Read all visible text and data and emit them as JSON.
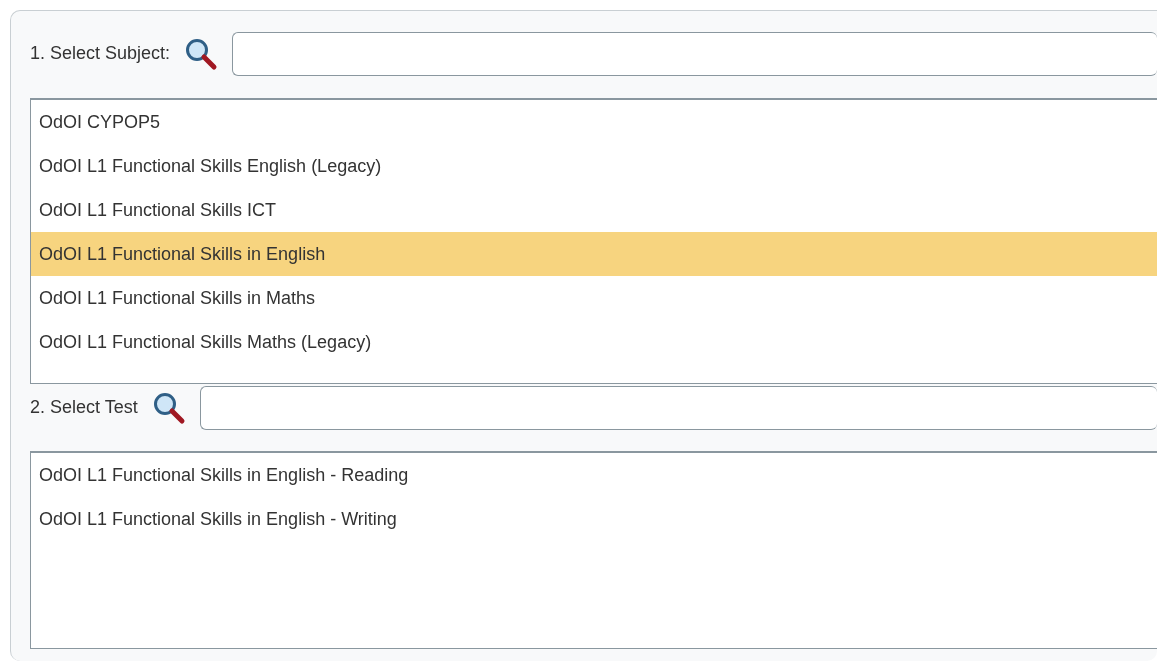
{
  "subject": {
    "label": "1. Select Subject:",
    "items": [
      {
        "label": "OdOI CYPOP5",
        "selected": false
      },
      {
        "label": "OdOI L1 Functional Skills English (Legacy)",
        "selected": false
      },
      {
        "label": "OdOI L1 Functional Skills ICT",
        "selected": false
      },
      {
        "label": "OdOI L1 Functional Skills in English",
        "selected": true
      },
      {
        "label": "OdOI L1 Functional Skills in Maths",
        "selected": false
      },
      {
        "label": "OdOI L1 Functional Skills Maths (Legacy)",
        "selected": false
      }
    ]
  },
  "test": {
    "label": "2. Select Test",
    "items": [
      {
        "label": "OdOI L1 Functional Skills in English - Reading",
        "selected": false
      },
      {
        "label": "OdOI L1 Functional Skills in English - Writing",
        "selected": false
      }
    ]
  }
}
